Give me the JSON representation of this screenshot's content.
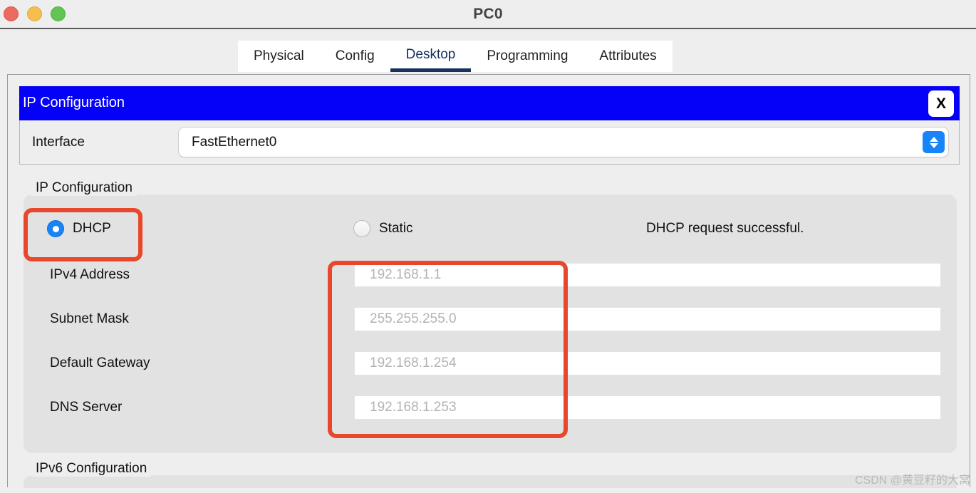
{
  "window": {
    "title": "PC0",
    "traffic_lights": [
      {
        "name": "close",
        "color": "#ec6a5f"
      },
      {
        "name": "minimize",
        "color": "#f5be4f"
      },
      {
        "name": "maximize",
        "color": "#61c554"
      }
    ]
  },
  "tabs": [
    {
      "label": "Physical",
      "active": false
    },
    {
      "label": "Config",
      "active": false
    },
    {
      "label": "Desktop",
      "active": true
    },
    {
      "label": "Programming",
      "active": false
    },
    {
      "label": "Attributes",
      "active": false
    }
  ],
  "dialog": {
    "header_title": "IP Configuration",
    "header_color": "#0500f8",
    "close_label": "X"
  },
  "interface": {
    "label": "Interface",
    "value": "FastEthernet0",
    "options": [
      "FastEthernet0"
    ]
  },
  "ip_configuration": {
    "group_label": "IP Configuration",
    "mode_options": [
      {
        "id": "dhcp",
        "label": "DHCP",
        "selected": true
      },
      {
        "id": "static",
        "label": "Static",
        "selected": false
      }
    ],
    "status_message": "DHCP request successful.",
    "fields": [
      {
        "label": "IPv4 Address",
        "value": "192.168.1.1",
        "placeholder": "192.168.1.1"
      },
      {
        "label": "Subnet Mask",
        "value": "255.255.255.0",
        "placeholder": "255.255.255.0"
      },
      {
        "label": "Default Gateway",
        "value": "192.168.1.254",
        "placeholder": "192.168.1.254"
      },
      {
        "label": "DNS Server",
        "value": "192.168.1.253",
        "placeholder": "192.168.1.253"
      }
    ]
  },
  "ipv6_configuration": {
    "group_label": "IPv6 Configuration"
  },
  "annotations": {
    "color": "#e8472b",
    "regions": [
      "dhcp-radio",
      "ip-address-fields"
    ]
  },
  "watermark": {
    "text": "CSDN @黄豆籽的大窝"
  }
}
